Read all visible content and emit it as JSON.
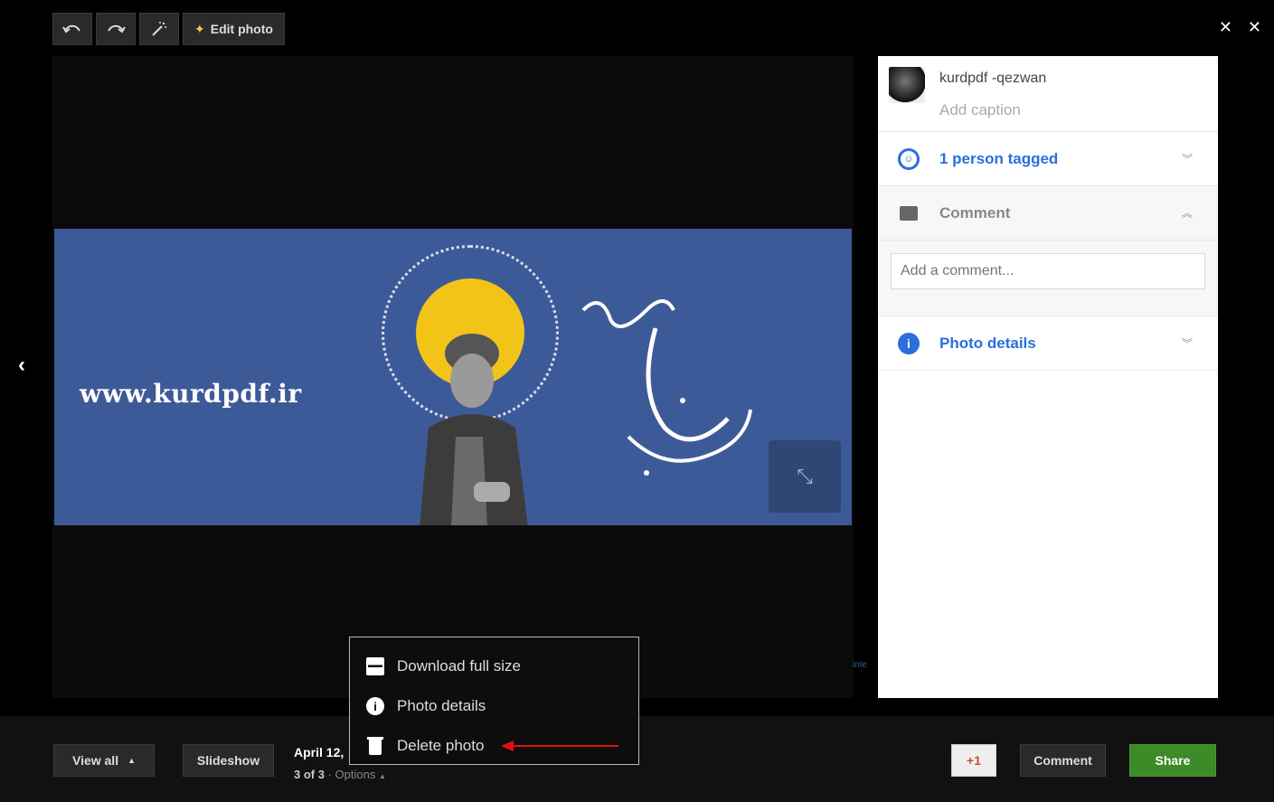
{
  "toolbar": {
    "undo_icon": "undo-icon",
    "redo_icon": "redo-icon",
    "auto_fix_icon": "magic-wand-icon",
    "edit_photo_label": "Edit photo",
    "close_label": "✕ ✕"
  },
  "photo": {
    "watermark_url": "www.kurdpdf.ir"
  },
  "panel": {
    "owner_name": "kurdpdf -qezwan",
    "add_caption": "Add caption",
    "tagged_label": "1 person tagged",
    "comment_label": "Comment",
    "comment_placeholder": "Add a comment...",
    "details_label": "Photo details"
  },
  "menu": {
    "items": [
      {
        "label": "Download full size",
        "icon": "download-icon"
      },
      {
        "label": "Photo details",
        "icon": "info-icon"
      },
      {
        "label": "Delete photo",
        "icon": "trash-icon"
      }
    ]
  },
  "bottom": {
    "view_all": "View all",
    "slideshow": "Slideshow",
    "date": "April 12,",
    "counter": "3 of 3",
    "options": "Options",
    "plus_one": "+1",
    "comment": "Comment",
    "share": "Share"
  },
  "colors": {
    "accent_blue": "#2a6fdb",
    "share_green": "#3d8a29",
    "photo_bg": "#3d5a98",
    "halo_yellow": "#f2c418",
    "arrow_red": "#e01010"
  }
}
